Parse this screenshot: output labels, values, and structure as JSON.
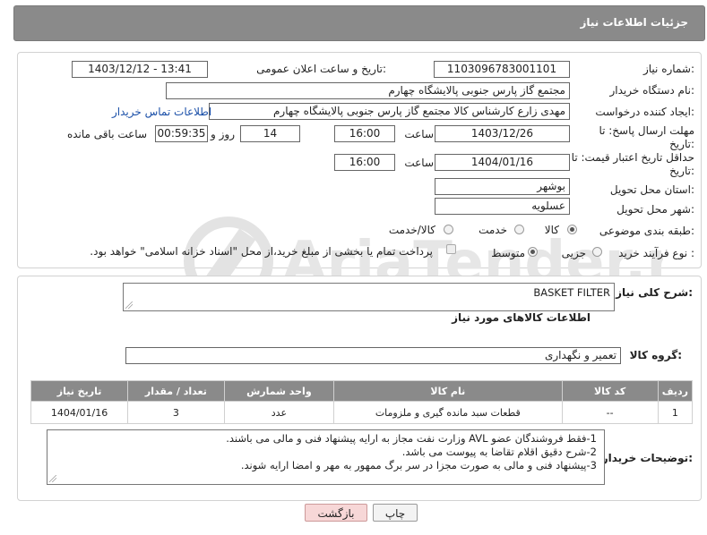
{
  "header": {
    "title": "جزئیات اطلاعات نیاز"
  },
  "form": {
    "need_number": {
      "label": "شماره نیاز:",
      "value": "1103096783001101"
    },
    "announce_datetime": {
      "label": "تاریخ و ساعت اعلان عمومی:",
      "value": "1403/12/12 - 13:41"
    },
    "buyer_org": {
      "label": "نام دستگاه خریدار:",
      "value": "مجتمع گاز پارس جنوبی  پالایشگاه چهارم"
    },
    "requester": {
      "label": "ایجاد کننده درخواست:",
      "value": "مهدی زارع کارشناس کالا مجتمع گاز پارس جنوبی  پالایشگاه چهارم"
    },
    "contact_link": "اطلاعات تماس خریدار",
    "deadline": {
      "label_line1": "مهلت ارسال پاسخ: تا",
      "label_line2": "تاریخ:",
      "date": "1403/12/26",
      "time_label": "ساعت",
      "time": "16:00",
      "days": "14",
      "days_label": "روز و",
      "remaining": "00:59:35",
      "remaining_label": "ساعت باقی مانده"
    },
    "price_validity": {
      "label_line1": "حداقل تاریخ اعتبار قیمت: تا",
      "label_line2": "تاریخ:",
      "date": "1404/01/16",
      "time_label": "ساعت",
      "time": "16:00"
    },
    "province": {
      "label": "استان محل تحویل:",
      "value": "بوشهر"
    },
    "city": {
      "label": "شهر محل تحویل:",
      "value": "عسلویه"
    },
    "category": {
      "label": "طبقه بندی موضوعی:",
      "options": [
        "کالا",
        "خدمت",
        "کالا/خدمت"
      ],
      "selected": "کالا"
    },
    "purchase_type": {
      "label": "نوع فرآیند خرید :",
      "options": [
        "جزیی",
        "متوسط"
      ],
      "selected": "متوسط",
      "payment_note": "پرداخت تمام یا بخشی از مبلغ خرید،از محل \"اسناد خزانه اسلامی\" خواهد بود."
    }
  },
  "description": {
    "label": "شرح کلی نیاز:",
    "value": "BASKET FILTER"
  },
  "goods_info_title": "اطلاعات کالاهای مورد نیاز",
  "goods_group": {
    "label": "گروه کالا:",
    "value": "تعمیر و نگهداری"
  },
  "table": {
    "headers": [
      "ردیف",
      "کد کالا",
      "نام کالا",
      "واحد شمارش",
      "تعداد / مقدار",
      "تاریخ نیاز"
    ],
    "rows": [
      [
        "1",
        "--",
        "قطعات سبد مانده گیری و ملزومات",
        "عدد",
        "3",
        "1404/01/16"
      ]
    ]
  },
  "buyer_notes": {
    "label": "توضیحات خریدار:",
    "lines": [
      "1-فقط فروشندگان عضو AVL وزارت نفت مجاز به ارایه پیشنهاد فنی و مالی می باشند.",
      "2-شرح دقیق اقلام تقاضا به پیوست می باشد.",
      "3-پیشنهاد فنی و مالی به صورت مجزا در سر برگ ممهور به مهر و امضا ارایه شوند."
    ]
  },
  "buttons": {
    "print": "چاپ",
    "back": "بازگشت"
  },
  "watermark_text": "AriaTender.neT",
  "colors": {
    "header_bg": "#8a8a8a",
    "link": "#1a4fa8",
    "back_button_bg": "#f7d7d7"
  }
}
